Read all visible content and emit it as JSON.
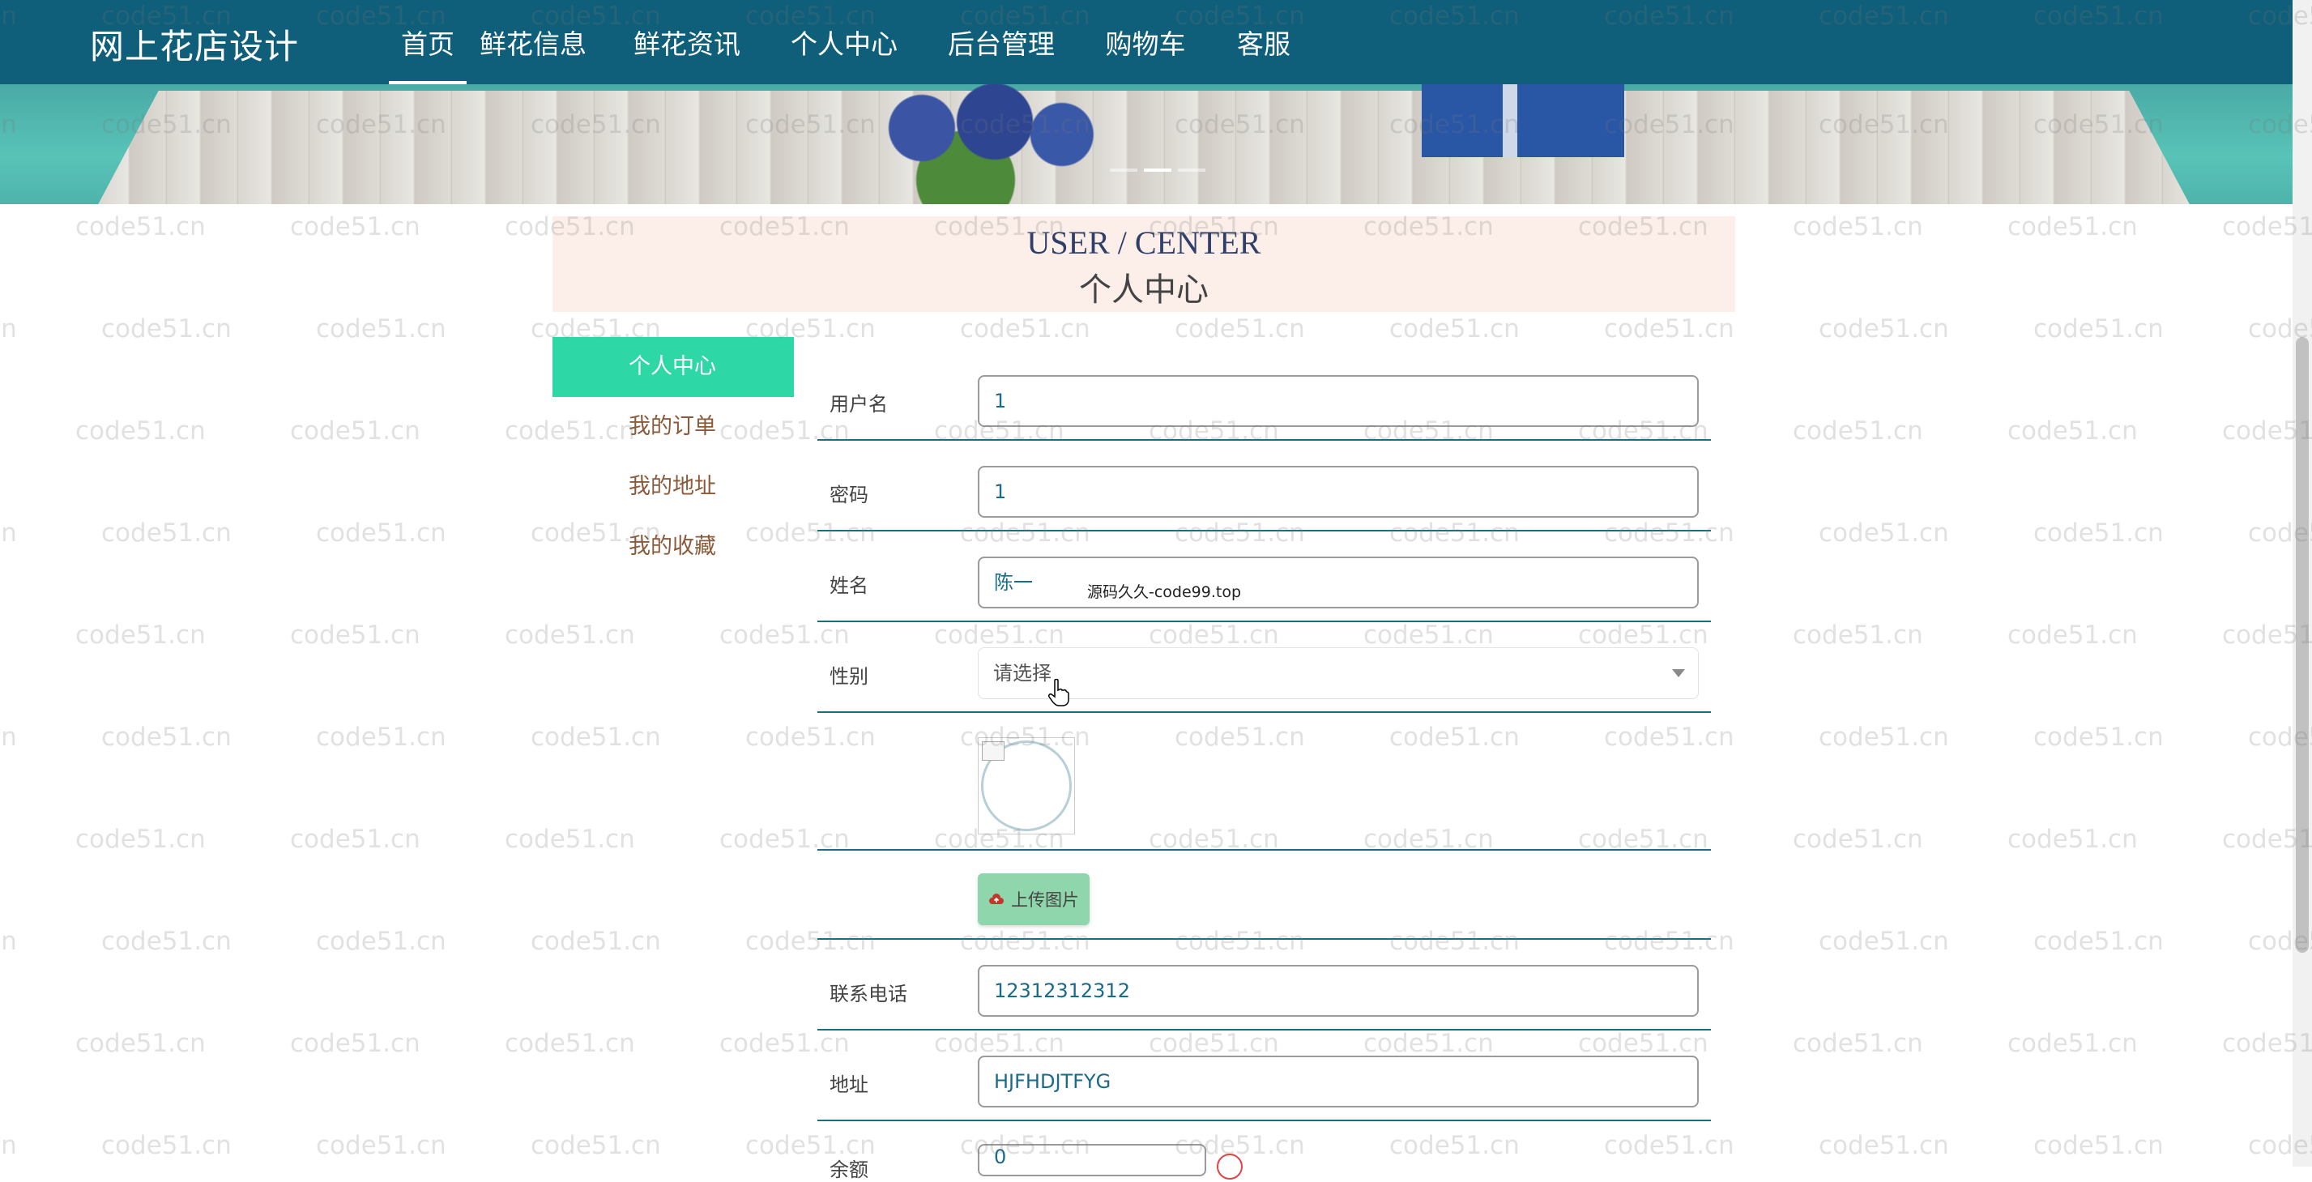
{
  "header": {
    "brand": "网上花店设计",
    "nav": [
      "首页",
      "鲜花信息",
      "鲜花资讯",
      "个人中心",
      "后台管理",
      "购物车",
      "客服"
    ],
    "active_index": 0
  },
  "title": {
    "en": "USER / CENTER",
    "cn": "个人中心"
  },
  "sidebar": {
    "items": [
      {
        "label": "个人中心",
        "active": true
      },
      {
        "label": "我的订单"
      },
      {
        "label": "我的地址"
      },
      {
        "label": "我的收藏"
      }
    ]
  },
  "form": {
    "username": {
      "label": "用户名",
      "value": "1"
    },
    "password": {
      "label": "密码",
      "value": "1"
    },
    "name": {
      "label": "姓名",
      "value": "陈一"
    },
    "gender": {
      "label": "性别",
      "placeholder": "请选择"
    },
    "upload": {
      "label": "上传图片"
    },
    "phone": {
      "label": "联系电话",
      "value": "12312312312"
    },
    "address": {
      "label": "地址",
      "value": "HJFHDJTFYG"
    },
    "balance": {
      "label": "余额",
      "value": "0"
    }
  },
  "overlay_text": "源码久久-code99.top",
  "watermark": "code51.cn",
  "colors": {
    "nav_bg": "#0f5e7a",
    "side_active": "#2ed8a6",
    "title_bg": "#fcefe9",
    "upload_bg": "#8fd6ac"
  },
  "icons": {
    "upload": "cloud-upload-icon",
    "select_caret": "chevron-down-icon",
    "pointer": "hand-cursor-icon"
  }
}
